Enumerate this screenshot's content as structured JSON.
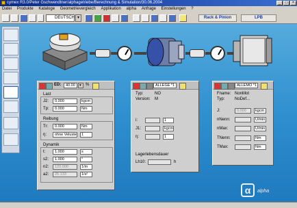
{
  "window": {
    "title": "cymex R3.0/Peter Gschwendtner/alphagetriebe/Berechnung & Simulation/30.06.2004",
    "minimize": "_",
    "maximize": "□",
    "close": "×"
  },
  "menu": [
    "Datei",
    "Produkte",
    "Kataloge",
    "Geometrievergleich",
    "Applikation",
    "alpha",
    "Anfrage",
    "Einstellungen",
    "?"
  ],
  "toolbar": {
    "language": "DEUTSCH",
    "rack_pinion": "Rack & Pinion",
    "lpb": "LPB"
  },
  "panel_left": {
    "ed_label": "ED:",
    "ed_value": "40.00",
    "ed_unit": "%",
    "last_label": "Last",
    "j2_label": "J2:",
    "j2_value": "0.000",
    "j2_unit": "kgcm",
    "tp_label": "Tp:",
    "tp_value": "0.000",
    "tp_unit": "Nm",
    "reibung_label": "Reibung",
    "tr_label": "Tr:",
    "tr_value": "0.000",
    "tr_unit": "Nm",
    "eta_label": "η:",
    "eta_value": "ohne Veluste",
    "eta_unit": "1",
    "dynamik_label": "Dynamik",
    "t_label": "t:",
    "t_value": "1.000",
    "t_unit": "s",
    "s2_label": "s2:",
    "s2_value": "1.000",
    "s2_unit": "°",
    "n2_label": "n2:",
    "n2_value": "120.000",
    "n2_unit": "1/m",
    "a2_label": "a2:",
    "a2_value": "25.133",
    "a2_unit": "1/s²"
  },
  "panel_mid": {
    "selector": "ALLEGE *1",
    "typ_label": "Typ:",
    "typ_value": "NO",
    "version_label": "Version:",
    "version_value": "M",
    "i_label": "i:",
    "i_unit": "1",
    "j1_label": "J1:",
    "j1_unit": "kgcm",
    "eta_label": "η:",
    "eta_unit": "1",
    "lager_label": "Lagerlebensdauer",
    "lh10_label": "Lh10:",
    "lh10_unit": "h"
  },
  "panel_right": {
    "selector": "ALLEMO *1",
    "fname_label": "Fname:",
    "fname_value": "NonMot",
    "typ_label": "Typ:",
    "typ_value": "NoDef...",
    "j_label": "J:",
    "j_value": "0.000",
    "j_unit": "kgcm",
    "nnenn_label": "nNenn:",
    "nnenn_unit": "U/min",
    "nmax_label": "nMax:",
    "nmax_unit": "U/min",
    "tnenn_label": "TNenn:",
    "tnenn_unit": "Nm",
    "tmax_label": "TMax:",
    "tmax_unit": "Nm"
  },
  "logo": "alpha"
}
